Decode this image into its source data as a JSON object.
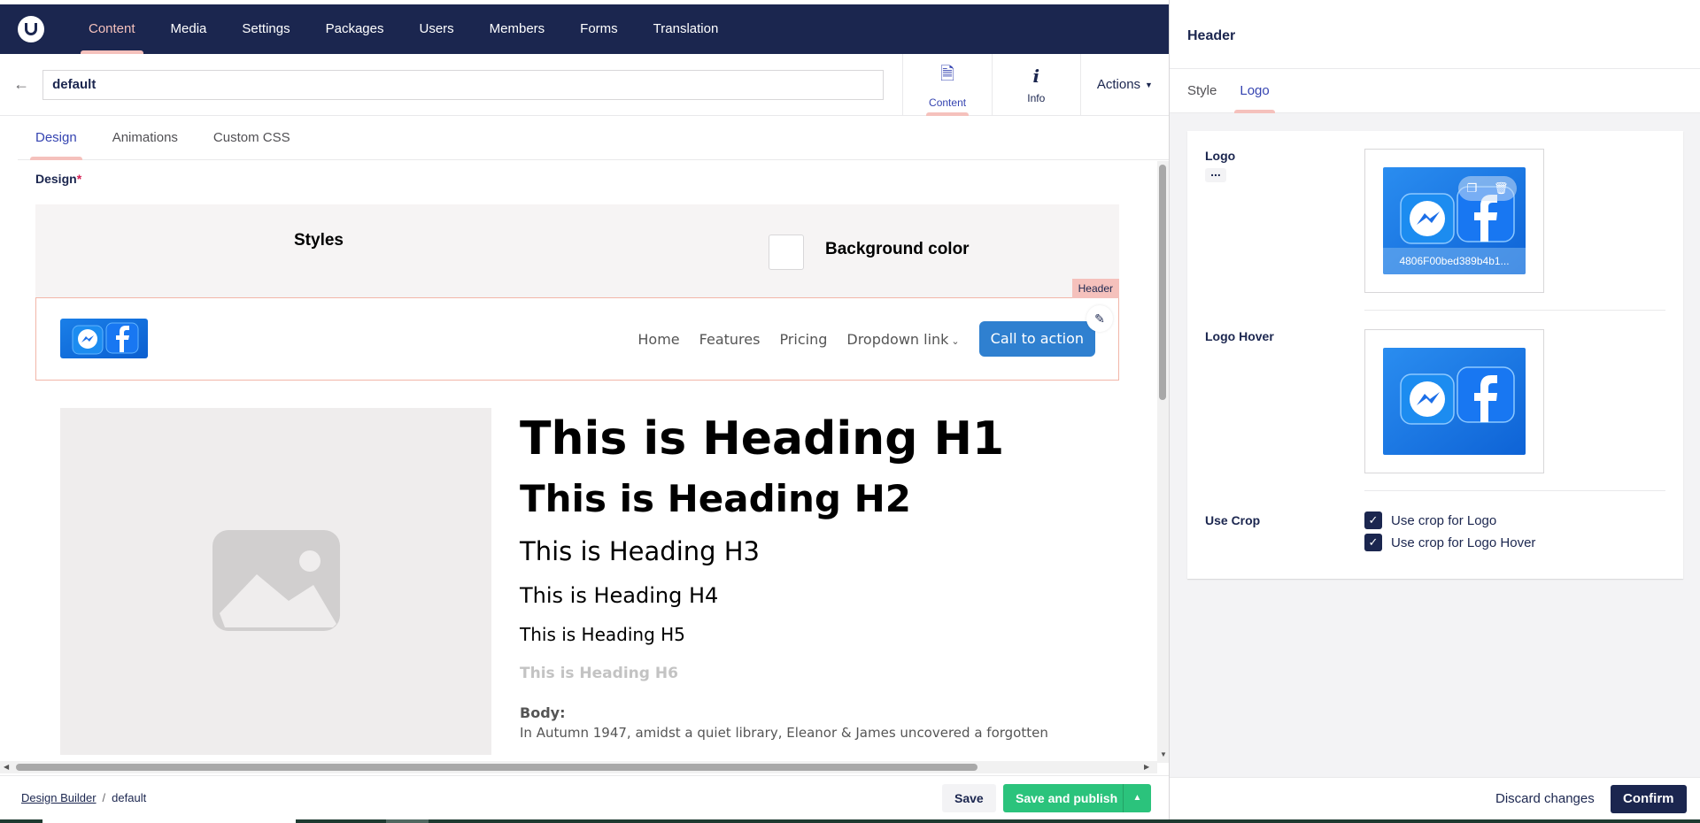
{
  "nav": {
    "items": [
      {
        "label": "Content",
        "active": true
      },
      {
        "label": "Media"
      },
      {
        "label": "Settings"
      },
      {
        "label": "Packages"
      },
      {
        "label": "Users"
      },
      {
        "label": "Members"
      },
      {
        "label": "Forms"
      },
      {
        "label": "Translation"
      }
    ]
  },
  "doc": {
    "name_value": "default",
    "apps": [
      {
        "label": "Content",
        "icon": "document-icon"
      },
      {
        "label": "Info",
        "icon": "info-icon"
      }
    ],
    "actions_label": "Actions"
  },
  "tabs": [
    {
      "label": "Design",
      "active": true
    },
    {
      "label": "Animations"
    },
    {
      "label": "Custom CSS"
    }
  ],
  "design": {
    "property_label": "Design",
    "required_mark": "*",
    "styles_title": "Styles",
    "bg_color_label": "Background color",
    "header_tag": "Header",
    "site_nav": [
      "Home",
      "Features",
      "Pricing",
      "Dropdown link"
    ],
    "cta_label": "Call to action",
    "headings": {
      "h1": "This is Heading H1",
      "h2": "This is Heading H2",
      "h3": "This is Heading H3",
      "h4": "This is Heading H4",
      "h5": "This is Heading H5",
      "h6": "This is Heading H6",
      "body_label": "Body:",
      "body_text": "In Autumn 1947, amidst a quiet library, Eleanor & James uncovered a forgotten"
    }
  },
  "footer": {
    "breadcrumb_root": "Design Builder",
    "breadcrumb_sep": "/",
    "breadcrumb_current": "default",
    "save_label": "Save",
    "publish_label": "Save and publish"
  },
  "panel": {
    "title": "Header",
    "tabs": [
      {
        "label": "Style"
      },
      {
        "label": "Logo",
        "active": true
      }
    ],
    "logo_label": "Logo",
    "logo_more": "...",
    "logo_filename": "4806F00bed389b4b1...",
    "logo_hover_label": "Logo Hover",
    "use_crop_label": "Use Crop",
    "crop_options": [
      {
        "label": "Use crop for Logo",
        "checked": true
      },
      {
        "label": "Use crop for Logo Hover",
        "checked": true
      }
    ],
    "discard_label": "Discard changes",
    "confirm_label": "Confirm"
  },
  "colors": {
    "nav_bg": "#1b264f",
    "accent": "#3544b1",
    "tab_indicator": "#f5c1bc",
    "publish": "#2bc37c",
    "cta": "#2f80d0"
  }
}
